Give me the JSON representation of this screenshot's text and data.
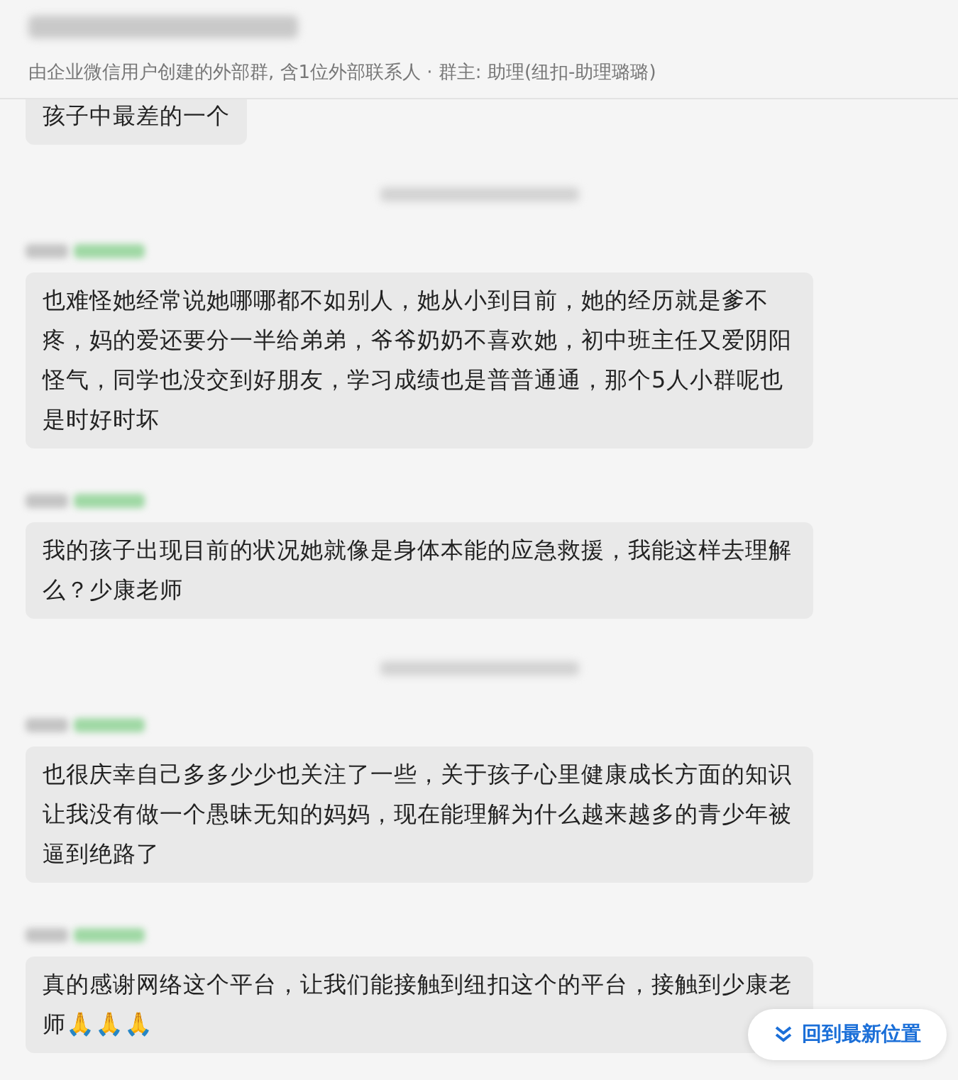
{
  "header": {
    "title_redacted": true,
    "subtitle": "由企业微信用户创建的外部群, 含1位外部联系人 · 群主: 助理(纽扣-助理璐璐)"
  },
  "messages": [
    {
      "kind": "message",
      "sender_visible": false,
      "text": "孩子中最差的一个"
    },
    {
      "kind": "time"
    },
    {
      "kind": "message",
      "sender_visible": true,
      "text": "也难怪她经常说她哪哪都不如别人，她从小到目前，她的经历就是爹不疼，妈的爱还要分一半给弟弟，爷爷奶奶不喜欢她，初中班主任又爱阴阳怪气，同学也没交到好朋友，学习成绩也是普普通通，那个5人小群呢也是时好时坏"
    },
    {
      "kind": "message",
      "sender_visible": true,
      "text": "我的孩子出现目前的状况她就像是身体本能的应急救援，我能这样去理解么？少康老师"
    },
    {
      "kind": "time"
    },
    {
      "kind": "message",
      "sender_visible": true,
      "text": "也很庆幸自己多多少少也关注了一些，关于孩子心里健康成长方面的知识让我没有做一个愚昧无知的妈妈，现在能理解为什么越来越多的青少年被逼到绝路了"
    },
    {
      "kind": "message",
      "sender_visible": true,
      "text": "真的感谢网络这个平台，让我们能接触到纽扣这个的平台，接触到少康老师🙏🙏🙏"
    }
  ],
  "jump_button": {
    "label": "回到最新位置"
  }
}
